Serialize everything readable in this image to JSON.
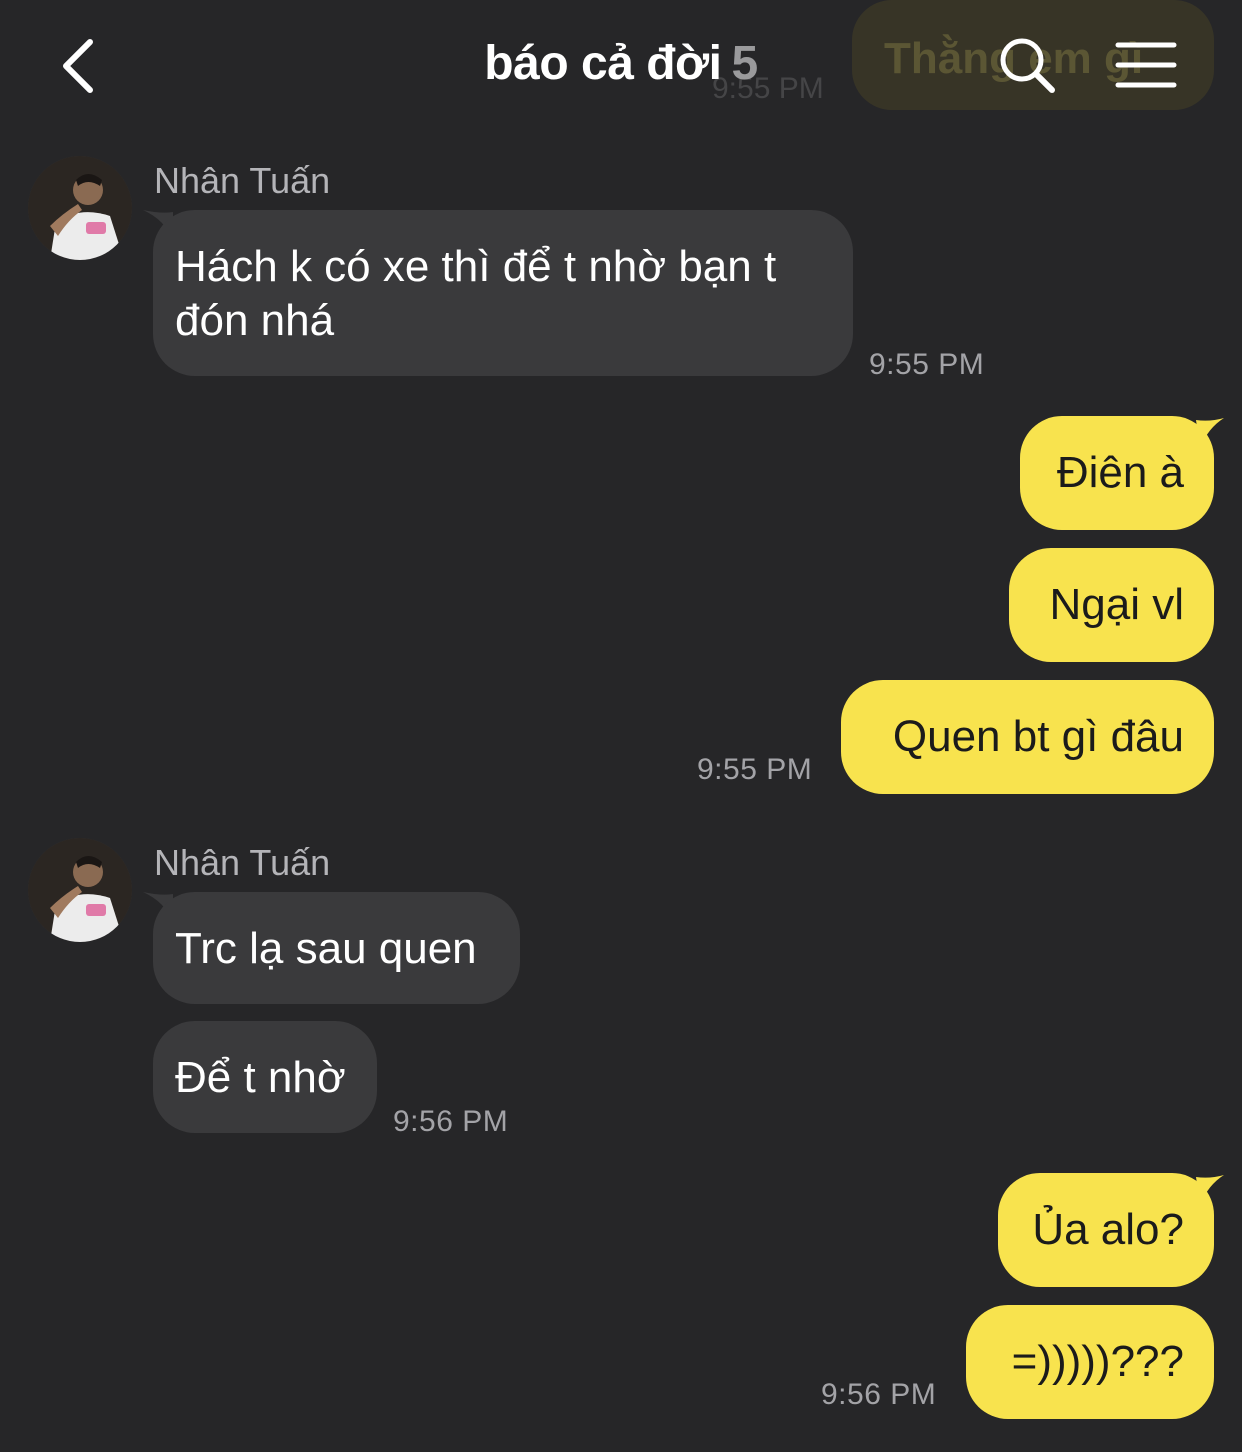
{
  "header": {
    "title": "báo cả đời",
    "member_count": "5",
    "ghost_text": "Thằng em gì",
    "ghost_time": "9:55 PM"
  },
  "messages": [
    {
      "sender": "Nhân Tuấn",
      "text": "Hách k có xe thì để t nhờ bạn t đón nhá",
      "time": "9:55 PM"
    },
    {
      "text": "Điên à"
    },
    {
      "text": "Ngại vl"
    },
    {
      "text": "Quen bt gì đâu",
      "time": "9:55 PM"
    },
    {
      "sender": "Nhân Tuấn",
      "text": "Trc lạ sau quen"
    },
    {
      "text": "Để t nhờ",
      "time": "9:56 PM"
    },
    {
      "text": "Ủa alo?"
    },
    {
      "text": "=)))))???",
      "time": "9:56 PM"
    }
  ],
  "colors": {
    "background": "#262628",
    "incoming_bubble": "#3a3a3c",
    "outgoing_bubble": "#f8e34e"
  },
  "icons": [
    "back-chevron-icon",
    "search-icon",
    "menu-icon"
  ]
}
